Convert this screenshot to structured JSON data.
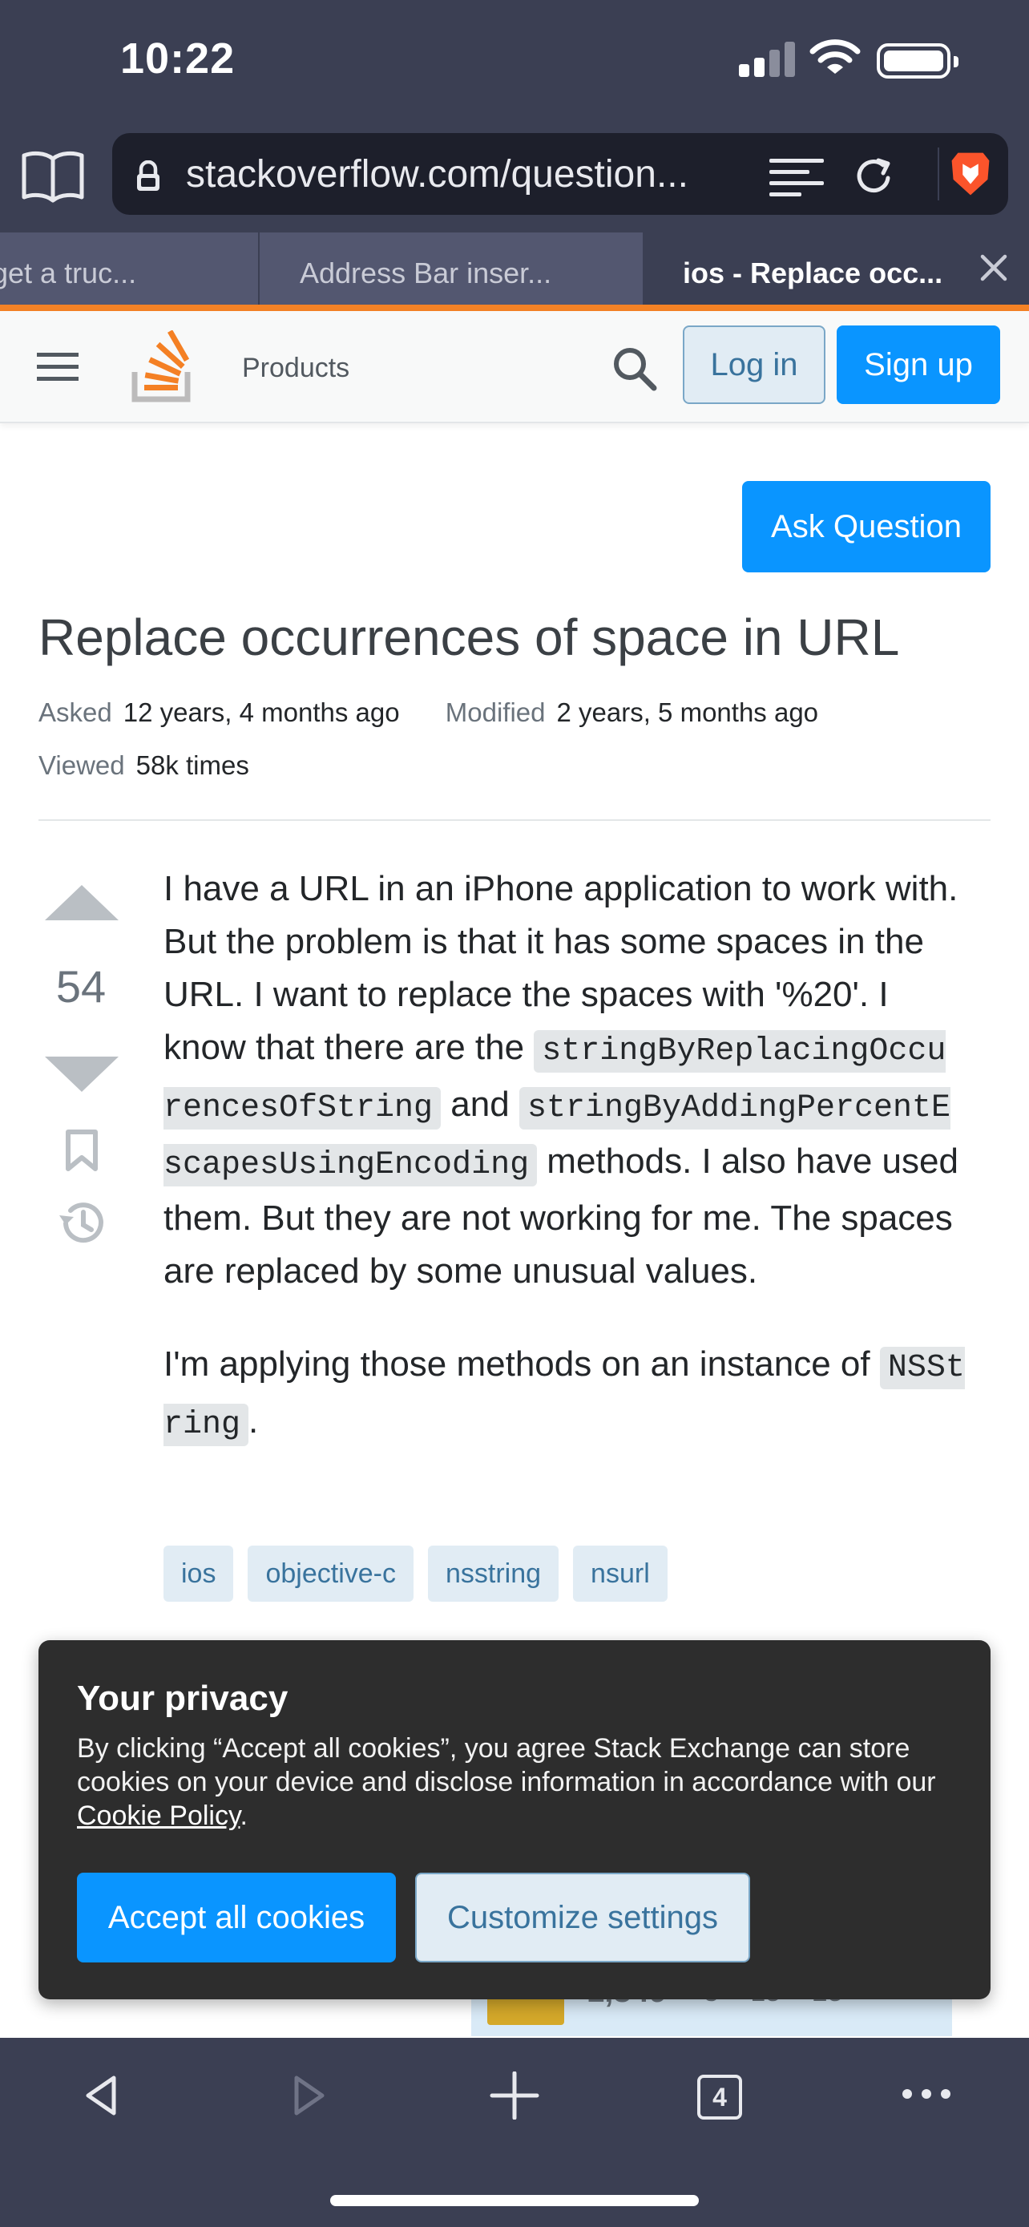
{
  "status_bar": {
    "time": "10:22"
  },
  "browser": {
    "url": "stackoverflow.com/question...",
    "tabs": [
      {
        "label": "get a truc..."
      },
      {
        "label": "Address Bar inser..."
      },
      {
        "label": "ios - Replace occ..."
      }
    ],
    "tab_count": "4"
  },
  "header": {
    "products": "Products",
    "login": "Log in",
    "signup": "Sign up"
  },
  "main": {
    "ask_button": "Ask Question",
    "title": "Replace occurrences of space in URL",
    "meta": {
      "asked_label": "Asked",
      "asked_value": "12 years, 4 months ago",
      "modified_label": "Modified",
      "modified_value": "2 years, 5 months ago",
      "viewed_label": "Viewed",
      "viewed_value": "58k times"
    },
    "score": "54",
    "post": {
      "p1_text1": "I have a URL in an iPhone application to work with. But the problem is that it has some spaces in the URL. I want to replace the spaces with '%20'. I know that there are the ",
      "code1": "stringByReplacingOccurencesOfString",
      "p1_text2": " and ",
      "code2": "stringByAddingPercentEscapesUsingEncoding",
      "p1_text3": " methods. I also have used them. But they are not working for me. The spaces are replaced by some unusual values.",
      "p2_text1": "I'm applying those methods on an instance of ",
      "code3": "NSString",
      "p2_text2": "."
    },
    "tags": [
      "ios",
      "objective-c",
      "nsstring",
      "nsurl"
    ],
    "user_card": {
      "rep": "1,349",
      "badges": "● 3 ● 15 ● 28"
    }
  },
  "cookie_banner": {
    "title": "Your privacy",
    "body_text": "By clicking “Accept all cookies”, you agree Stack Exchange can store cookies on your device and disclose information in accordance with our ",
    "policy_link": "Cookie Policy",
    "body_end": ".",
    "accept": "Accept all cookies",
    "customize": "Customize settings"
  },
  "colors": {
    "chrome": "#3b3f53",
    "so_orange": "#f48225",
    "so_blue": "#0a95ff",
    "tag_bg": "#e1ecf4",
    "tag_text": "#39739d"
  }
}
